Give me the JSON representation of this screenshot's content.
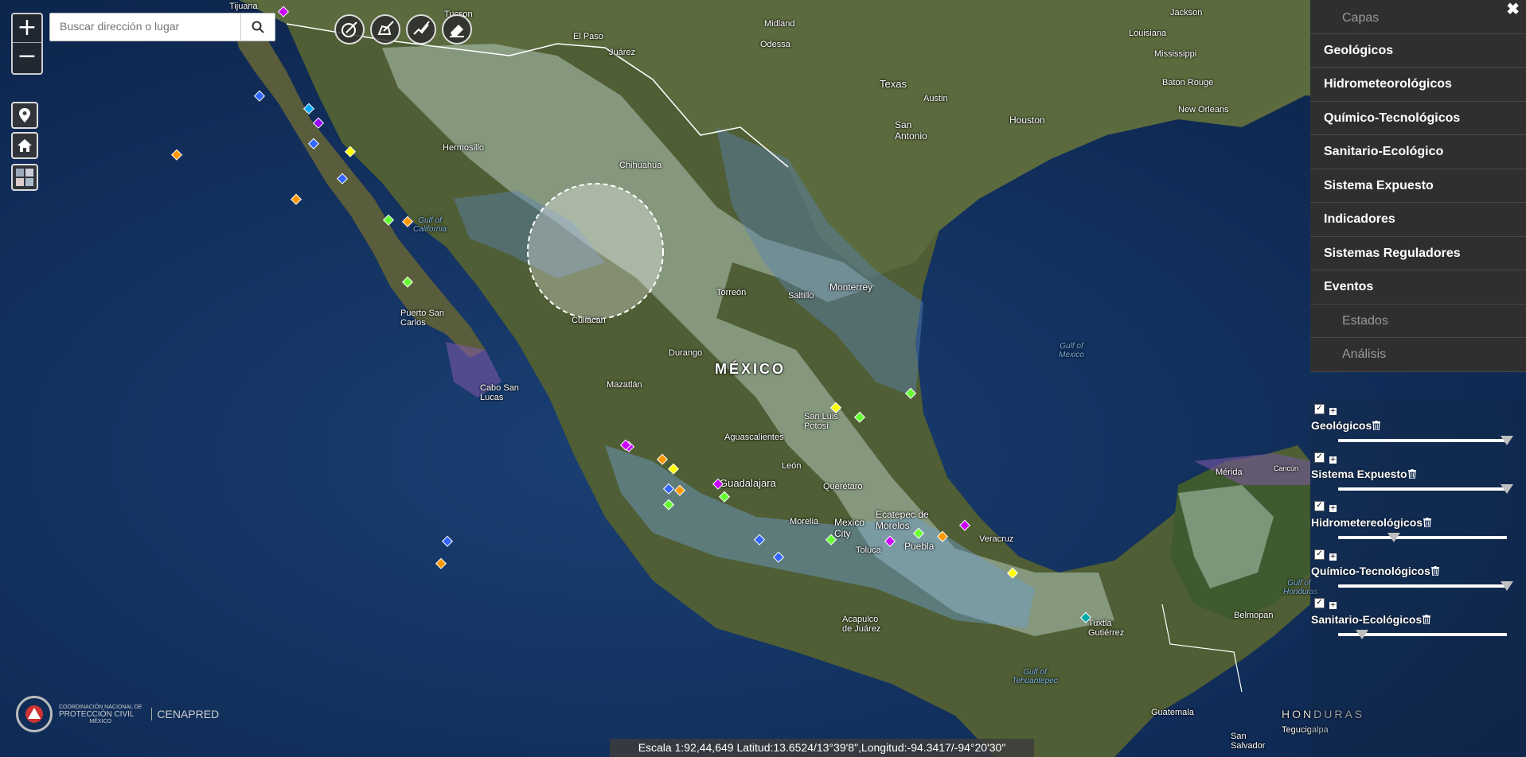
{
  "search": {
    "placeholder": "Buscar dirección o lugar"
  },
  "zoom": {
    "in_label": "+",
    "out_label": "−"
  },
  "panel": {
    "close_label": "✖",
    "menu": [
      {
        "label": "Capas",
        "type": "sub"
      },
      {
        "label": "Geológicos",
        "type": "main"
      },
      {
        "label": "Hidrometeorológicos",
        "type": "main"
      },
      {
        "label": "Químico-Tecnológicos",
        "type": "main"
      },
      {
        "label": "Sanitario-Ecológico",
        "type": "main"
      },
      {
        "label": "Sistema Expuesto",
        "type": "main"
      },
      {
        "label": "Indicadores",
        "type": "main"
      },
      {
        "label": "Sistemas Reguladores",
        "type": "main"
      },
      {
        "label": "Eventos",
        "type": "main"
      },
      {
        "label": "Estados",
        "type": "sub"
      },
      {
        "label": "Análisis",
        "type": "sub"
      }
    ],
    "layers": [
      {
        "name": "Geológicos",
        "checked": true,
        "opacity": 1.0
      },
      {
        "name": "Sistema Expuesto",
        "checked": true,
        "opacity": 1.0
      },
      {
        "name": "Hidrometereológicos",
        "checked": true,
        "opacity": 0.33
      },
      {
        "name": "Químico-Tecnológicos",
        "checked": true,
        "opacity": 1.0
      },
      {
        "name": "Sanitario-Ecológicos",
        "checked": true,
        "opacity": 0.14
      }
    ]
  },
  "status": {
    "scale_text": "Escala 1:92,44,649 Latitud:13.6524/13°39'8\",Longitud:-94.3417/-94°20'30\""
  },
  "logo": {
    "line1": "COORDINACIÓN NACIONAL DE",
    "line2": "PROTECCIÓN CIVIL",
    "line3": "MÉXICO",
    "brand": "CENAPRED"
  },
  "map_labels": [
    {
      "text": "Tijuana",
      "kind": "city"
    },
    {
      "text": "Tucson",
      "kind": "city"
    },
    {
      "text": "Midland",
      "kind": "city"
    },
    {
      "text": "Odessa",
      "kind": "city"
    },
    {
      "text": "El Paso",
      "kind": "city"
    },
    {
      "text": "Juárez",
      "kind": "city"
    },
    {
      "text": "Louisiana",
      "kind": "city"
    },
    {
      "text": "Jackson",
      "kind": "city"
    },
    {
      "text": "Mississippi",
      "kind": "city"
    },
    {
      "text": "Texas",
      "kind": "city"
    },
    {
      "text": "Austin",
      "kind": "city"
    },
    {
      "text": "Baton Rouge",
      "kind": "city"
    },
    {
      "text": "New Orleans",
      "kind": "city"
    },
    {
      "text": "Houston",
      "kind": "city"
    },
    {
      "text": "San Antonio",
      "kind": "city"
    },
    {
      "text": "Hermosillo",
      "kind": "city"
    },
    {
      "text": "Chihuahua",
      "kind": "city"
    },
    {
      "text": "Gulf of California",
      "kind": "water"
    },
    {
      "text": "Torreón",
      "kind": "city"
    },
    {
      "text": "Saltillo",
      "kind": "city"
    },
    {
      "text": "Monterrey",
      "kind": "city"
    },
    {
      "text": "Puerto San Carlos",
      "kind": "city"
    },
    {
      "text": "Culiacán",
      "kind": "city"
    },
    {
      "text": "Durango",
      "kind": "city"
    },
    {
      "text": "MÉXICO",
      "kind": "country"
    },
    {
      "text": "Gulf of Mexico",
      "kind": "water"
    },
    {
      "text": "Cabo San Lucas",
      "kind": "city"
    },
    {
      "text": "Mazatlán",
      "kind": "city"
    },
    {
      "text": "San Luis Potosí",
      "kind": "city"
    },
    {
      "text": "Aguascalientes",
      "kind": "city"
    },
    {
      "text": "León",
      "kind": "city"
    },
    {
      "text": "Guadalajara",
      "kind": "city"
    },
    {
      "text": "Querétaro",
      "kind": "city"
    },
    {
      "text": "Morelia",
      "kind": "city"
    },
    {
      "text": "Mexico City",
      "kind": "city"
    },
    {
      "text": "Ecatepec de Morelos",
      "kind": "city"
    },
    {
      "text": "Toluca",
      "kind": "city"
    },
    {
      "text": "Puebla",
      "kind": "city"
    },
    {
      "text": "Veracruz",
      "kind": "city"
    },
    {
      "text": "Mérida",
      "kind": "city"
    },
    {
      "text": "Cancún",
      "kind": "city"
    },
    {
      "text": "Acapulco de Juárez",
      "kind": "city"
    },
    {
      "text": "Tuxtla Gutiérrez",
      "kind": "city"
    },
    {
      "text": "Belmopan",
      "kind": "city"
    },
    {
      "text": "Gulf of Tehuantepec",
      "kind": "water"
    },
    {
      "text": "Guatemala",
      "kind": "city"
    },
    {
      "text": "HONDURAS",
      "kind": "country"
    },
    {
      "text": "Tegucigalpa",
      "kind": "city"
    },
    {
      "text": "San Salvador",
      "kind": "city"
    },
    {
      "text": "Gulf of Honduras",
      "kind": "water"
    }
  ]
}
